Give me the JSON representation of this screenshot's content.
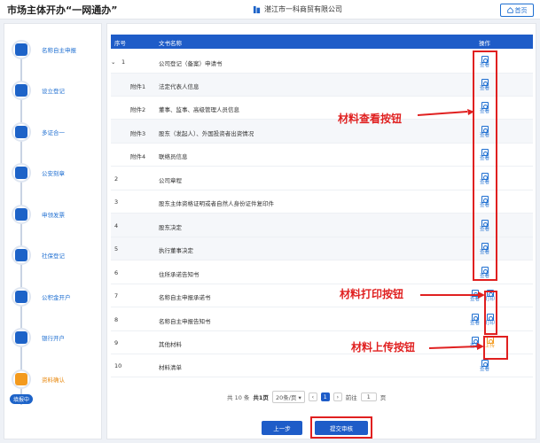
{
  "header": {
    "app_title": "市场主体开办“一网通办”",
    "company": "湛江市一科商贸有限公司",
    "home_label": "首页"
  },
  "sidebar": {
    "items": [
      {
        "label": "名称自主申报",
        "icon": "name-declare-icon"
      },
      {
        "label": "设立登记",
        "icon": "register-icon"
      },
      {
        "label": "多证合一",
        "icon": "multi-license-icon"
      },
      {
        "label": "公安刻章",
        "icon": "seal-icon"
      },
      {
        "label": "申领发票",
        "icon": "invoice-icon"
      },
      {
        "label": "社保登记",
        "icon": "social-security-icon"
      },
      {
        "label": "公积金开户",
        "icon": "housing-fund-icon"
      },
      {
        "label": "银行开户",
        "icon": "bank-icon"
      },
      {
        "label": "资料确认",
        "icon": "document-confirm-icon"
      }
    ],
    "filling_badge": "填报中"
  },
  "table": {
    "headers": {
      "seq": "序号",
      "name": "文书名称",
      "action": "操作"
    },
    "rows": [
      {
        "seq": "1",
        "name": "公司登记（备案）申请书",
        "action_label": "查看"
      },
      {
        "seq": "附件1",
        "name": "法定代表人信息",
        "action_label": "查看"
      },
      {
        "seq": "附件2",
        "name": "董事、监事、高级管理人员信息",
        "action_label": "查看"
      },
      {
        "seq": "附件3",
        "name": "股东（发起人）、外国投资者出资情况",
        "action_label": "查看"
      },
      {
        "seq": "附件4",
        "name": "联络员信息",
        "action_label": "查看"
      },
      {
        "seq": "2",
        "name": "公司章程",
        "action_label": "查看"
      },
      {
        "seq": "3",
        "name": "股东主体资格证明或者自然人身份证件复印件",
        "action_label": "查看"
      },
      {
        "seq": "4",
        "name": "股东决定",
        "action_label": "查看"
      },
      {
        "seq": "5",
        "name": "执行董事决定",
        "action_label": "查看"
      },
      {
        "seq": "6",
        "name": "住所承诺告知书",
        "action_label": "查看"
      },
      {
        "seq": "7",
        "name": "名称自主申报承诺书",
        "action_label": "查看",
        "extra_label": "打印"
      },
      {
        "seq": "8",
        "name": "名称自主申报告知书",
        "action_label": "查看",
        "extra_label": "打印"
      },
      {
        "seq": "9",
        "name": "其他材料",
        "action_label": "查看",
        "extra_label": "上传"
      },
      {
        "seq": "10",
        "name": "材料清单",
        "action_label": "查看"
      }
    ]
  },
  "annotations": {
    "view": "材料查看按钮",
    "print": "材料打印按钮",
    "upload": "材料上传按钮"
  },
  "pagination": {
    "total": "共 10 条",
    "pages": "共1页",
    "page_size": "20条/页",
    "current_page": "1",
    "goto_label": "前往",
    "goto_value": "1",
    "page_unit": "页"
  },
  "buttons": {
    "prev": "上一步",
    "submit": "提交审核"
  },
  "colors": {
    "primary": "#1e5cc8",
    "accent_orange": "#f39a1e",
    "annotation_red": "#e02020"
  }
}
